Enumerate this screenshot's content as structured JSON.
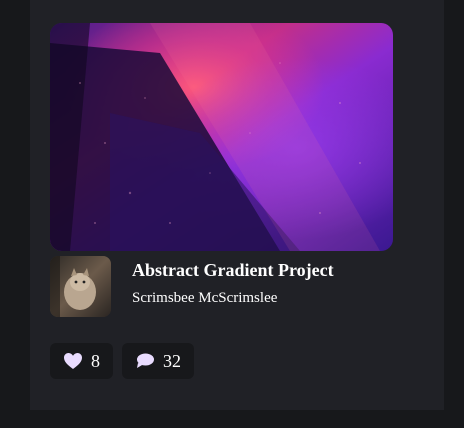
{
  "project": {
    "title": "Abstract Gradient Project",
    "author": "Scrimsbee McScrimslee"
  },
  "stats": {
    "likes": "8",
    "comments": "32"
  },
  "icons": {
    "likes": "heart-icon",
    "comments": "speech-bubble-icon"
  },
  "colors": {
    "page_background": "#17181b",
    "card_background": "#202126",
    "stat_background": "#17181b",
    "text": "#ffffff",
    "icon_fill": "#e9dcff"
  }
}
